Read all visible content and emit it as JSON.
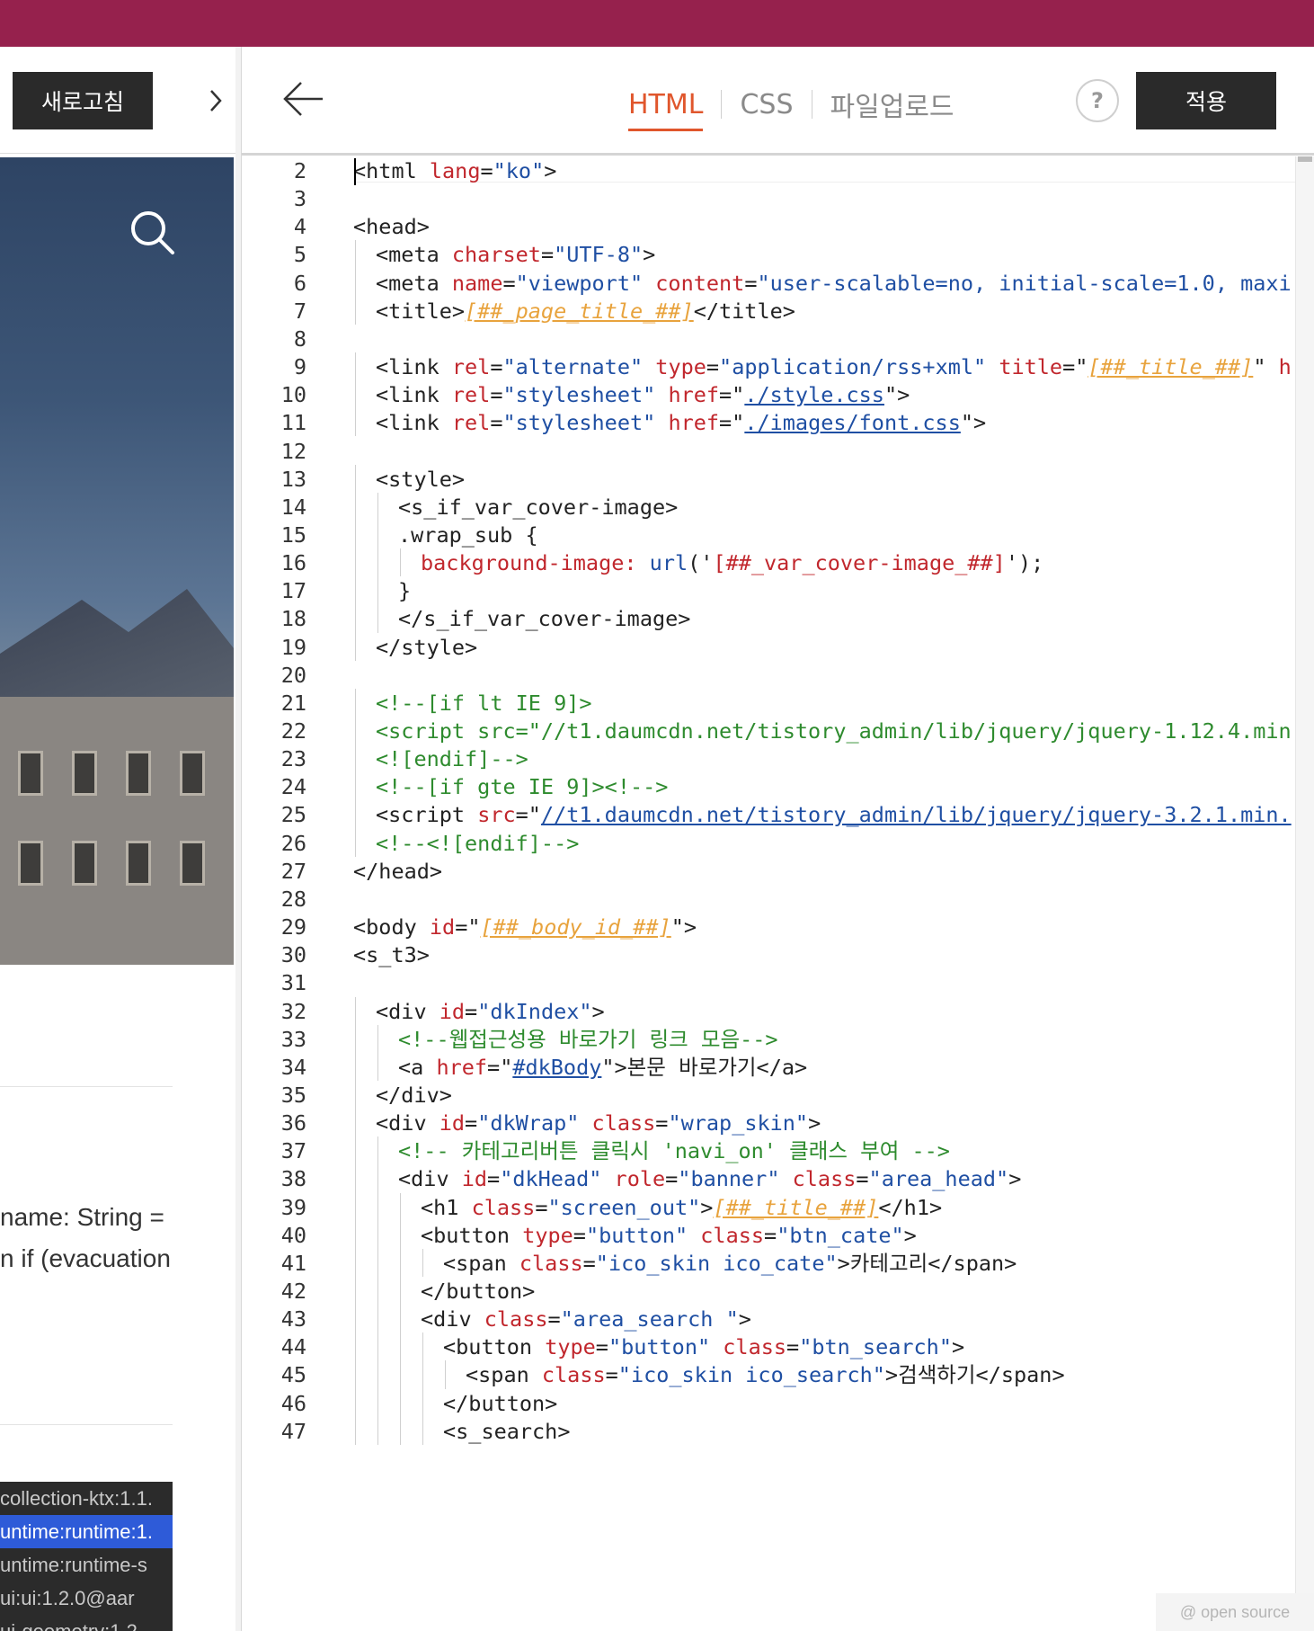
{
  "left": {
    "refresh_label": "새로고침",
    "toggle_glyph": "›",
    "text_line1": "name: String =",
    "text_line2": "n if (evacuation",
    "deps": [
      "collection-ktx:1.1.",
      "untime:runtime:1.",
      "untime:runtime-s",
      "ui:ui:1.2.0@aar",
      "ui-geometry:1.2"
    ]
  },
  "editor": {
    "tabs": [
      {
        "label": "HTML",
        "active": true
      },
      {
        "label": "CSS",
        "active": false
      },
      {
        "label": "파일업로드",
        "active": false
      }
    ],
    "help_label": "?",
    "apply_label": "적용",
    "badge": "@ open source",
    "colors": {
      "topbar": "#96214d",
      "active_tab": "#e0562c"
    }
  },
  "code_lines": [
    {
      "n": "2",
      "indent": 0,
      "seg": [
        [
          "t",
          "<html "
        ],
        [
          "a",
          "lang"
        ],
        [
          "t",
          "="
        ],
        [
          "s",
          "\"ko\""
        ],
        [
          "t",
          ">"
        ]
      ]
    },
    {
      "n": "3",
      "indent": 0,
      "seg": []
    },
    {
      "n": "4",
      "indent": 0,
      "seg": [
        [
          "t",
          "<head>"
        ]
      ]
    },
    {
      "n": "5",
      "indent": 1,
      "seg": [
        [
          "t",
          "<meta "
        ],
        [
          "a",
          "charset"
        ],
        [
          "t",
          "="
        ],
        [
          "s",
          "\"UTF-8\""
        ],
        [
          "t",
          ">"
        ]
      ]
    },
    {
      "n": "6",
      "indent": 1,
      "seg": [
        [
          "t",
          "<meta "
        ],
        [
          "a",
          "name"
        ],
        [
          "t",
          "="
        ],
        [
          "s",
          "\"viewport\""
        ],
        [
          "t",
          " "
        ],
        [
          "a",
          "content"
        ],
        [
          "t",
          "="
        ],
        [
          "s",
          "\"user-scalable=no, initial-scale=1.0, maxi"
        ]
      ]
    },
    {
      "n": "7",
      "indent": 1,
      "seg": [
        [
          "t",
          "<title>"
        ],
        [
          "tv",
          "[##_page_title_##]"
        ],
        [
          "t",
          "</title>"
        ]
      ]
    },
    {
      "n": "8",
      "indent": 0,
      "seg": []
    },
    {
      "n": "9",
      "indent": 1,
      "seg": [
        [
          "t",
          "<link "
        ],
        [
          "a",
          "rel"
        ],
        [
          "t",
          "="
        ],
        [
          "s",
          "\"alternate\""
        ],
        [
          "t",
          " "
        ],
        [
          "a",
          "type"
        ],
        [
          "t",
          "="
        ],
        [
          "s",
          "\"application/rss+xml\""
        ],
        [
          "t",
          " "
        ],
        [
          "a",
          "title"
        ],
        [
          "t",
          "=\""
        ],
        [
          "tv",
          "[##_title_##]"
        ],
        [
          "t",
          "\" "
        ],
        [
          "a",
          "h"
        ]
      ]
    },
    {
      "n": "10",
      "indent": 1,
      "seg": [
        [
          "t",
          "<link "
        ],
        [
          "a",
          "rel"
        ],
        [
          "t",
          "="
        ],
        [
          "s",
          "\"stylesheet\""
        ],
        [
          "t",
          " "
        ],
        [
          "a",
          "href"
        ],
        [
          "t",
          "=\""
        ],
        [
          "u",
          "./style.css"
        ],
        [
          "t",
          "\">"
        ]
      ]
    },
    {
      "n": "11",
      "indent": 1,
      "seg": [
        [
          "t",
          "<link "
        ],
        [
          "a",
          "rel"
        ],
        [
          "t",
          "="
        ],
        [
          "s",
          "\"stylesheet\""
        ],
        [
          "t",
          " "
        ],
        [
          "a",
          "href"
        ],
        [
          "t",
          "=\""
        ],
        [
          "u",
          "./images/font.css"
        ],
        [
          "t",
          "\">"
        ]
      ]
    },
    {
      "n": "12",
      "indent": 0,
      "seg": []
    },
    {
      "n": "13",
      "indent": 1,
      "seg": [
        [
          "t",
          "<style>"
        ]
      ]
    },
    {
      "n": "14",
      "indent": 2,
      "seg": [
        [
          "t",
          "<s_if_var_cover-image>"
        ]
      ]
    },
    {
      "n": "15",
      "indent": 2,
      "seg": [
        [
          "t",
          ".wrap_sub {"
        ]
      ]
    },
    {
      "n": "16",
      "indent": 3,
      "seg": [
        [
          "a",
          "background-image: "
        ],
        [
          "s",
          "url"
        ],
        [
          "t",
          "('"
        ],
        [
          "a",
          "[##_var_cover-image_##]"
        ],
        [
          "t",
          "');"
        ]
      ]
    },
    {
      "n": "17",
      "indent": 2,
      "seg": [
        [
          "t",
          "}"
        ]
      ]
    },
    {
      "n": "18",
      "indent": 2,
      "seg": [
        [
          "t",
          "</s_if_var_cover-image>"
        ]
      ]
    },
    {
      "n": "19",
      "indent": 1,
      "seg": [
        [
          "t",
          "</style>"
        ]
      ]
    },
    {
      "n": "20",
      "indent": 0,
      "seg": []
    },
    {
      "n": "21",
      "indent": 1,
      "seg": [
        [
          "c",
          "<!--[if lt IE 9]>"
        ]
      ]
    },
    {
      "n": "22",
      "indent": 1,
      "seg": [
        [
          "c",
          "<script src=\"//t1.daumcdn.net/tistory_admin/lib/jquery/jquery-1.12.4.min"
        ]
      ]
    },
    {
      "n": "23",
      "indent": 1,
      "seg": [
        [
          "c",
          "<![endif]-->"
        ]
      ]
    },
    {
      "n": "24",
      "indent": 1,
      "seg": [
        [
          "c",
          "<!--[if gte IE 9]><!-->"
        ]
      ]
    },
    {
      "n": "25",
      "indent": 1,
      "seg": [
        [
          "t",
          "<script "
        ],
        [
          "a",
          "src"
        ],
        [
          "t",
          "=\""
        ],
        [
          "u",
          "//t1.daumcdn.net/tistory_admin/lib/jquery/jquery-3.2.1.min."
        ]
      ]
    },
    {
      "n": "26",
      "indent": 1,
      "seg": [
        [
          "c",
          "<!--<![endif]-->"
        ]
      ]
    },
    {
      "n": "27",
      "indent": 0,
      "seg": [
        [
          "t",
          "</head>"
        ]
      ]
    },
    {
      "n": "28",
      "indent": 0,
      "seg": []
    },
    {
      "n": "29",
      "indent": 0,
      "seg": [
        [
          "t",
          "<body "
        ],
        [
          "a",
          "id"
        ],
        [
          "t",
          "=\""
        ],
        [
          "tv",
          "[##_body_id_##]"
        ],
        [
          "t",
          "\">"
        ]
      ]
    },
    {
      "n": "30",
      "indent": 0,
      "seg": [
        [
          "t",
          "<s_t3>"
        ]
      ]
    },
    {
      "n": "31",
      "indent": 0,
      "seg": []
    },
    {
      "n": "32",
      "indent": 1,
      "seg": [
        [
          "t",
          "<div "
        ],
        [
          "a",
          "id"
        ],
        [
          "t",
          "="
        ],
        [
          "s",
          "\"dkIndex\""
        ],
        [
          "t",
          ">"
        ]
      ]
    },
    {
      "n": "33",
      "indent": 2,
      "seg": [
        [
          "c",
          "<!--웹접근성용 바로가기 링크 모음-->"
        ]
      ]
    },
    {
      "n": "34",
      "indent": 2,
      "seg": [
        [
          "t",
          "<a "
        ],
        [
          "a",
          "href"
        ],
        [
          "t",
          "=\""
        ],
        [
          "u",
          "#dkBody"
        ],
        [
          "t",
          "\">본문 바로가기</a>"
        ]
      ]
    },
    {
      "n": "35",
      "indent": 1,
      "seg": [
        [
          "t",
          "</div>"
        ]
      ]
    },
    {
      "n": "36",
      "indent": 1,
      "seg": [
        [
          "t",
          "<div "
        ],
        [
          "a",
          "id"
        ],
        [
          "t",
          "="
        ],
        [
          "s",
          "\"dkWrap\""
        ],
        [
          "t",
          " "
        ],
        [
          "a",
          "class"
        ],
        [
          "t",
          "="
        ],
        [
          "s",
          "\"wrap_skin\""
        ],
        [
          "t",
          ">"
        ]
      ]
    },
    {
      "n": "37",
      "indent": 2,
      "seg": [
        [
          "c",
          "<!-- 카테고리버튼 클릭시 'navi_on' 클래스 부여 -->"
        ]
      ]
    },
    {
      "n": "38",
      "indent": 2,
      "seg": [
        [
          "t",
          "<div "
        ],
        [
          "a",
          "id"
        ],
        [
          "t",
          "="
        ],
        [
          "s",
          "\"dkHead\""
        ],
        [
          "t",
          " "
        ],
        [
          "a",
          "role"
        ],
        [
          "t",
          "="
        ],
        [
          "s",
          "\"banner\""
        ],
        [
          "t",
          " "
        ],
        [
          "a",
          "class"
        ],
        [
          "t",
          "="
        ],
        [
          "s",
          "\"area_head\""
        ],
        [
          "t",
          ">"
        ]
      ]
    },
    {
      "n": "39",
      "indent": 3,
      "seg": [
        [
          "t",
          "<h1 "
        ],
        [
          "a",
          "class"
        ],
        [
          "t",
          "="
        ],
        [
          "s",
          "\"screen_out\""
        ],
        [
          "t",
          ">"
        ],
        [
          "tv",
          "[##_title_##]"
        ],
        [
          "t",
          "</h1>"
        ]
      ]
    },
    {
      "n": "40",
      "indent": 3,
      "seg": [
        [
          "t",
          "<button "
        ],
        [
          "a",
          "type"
        ],
        [
          "t",
          "="
        ],
        [
          "s",
          "\"button\""
        ],
        [
          "t",
          " "
        ],
        [
          "a",
          "class"
        ],
        [
          "t",
          "="
        ],
        [
          "s",
          "\"btn_cate\""
        ],
        [
          "t",
          ">"
        ]
      ]
    },
    {
      "n": "41",
      "indent": 4,
      "seg": [
        [
          "t",
          "<span "
        ],
        [
          "a",
          "class"
        ],
        [
          "t",
          "="
        ],
        [
          "s",
          "\"ico_skin ico_cate\""
        ],
        [
          "t",
          ">카테고리</span>"
        ]
      ]
    },
    {
      "n": "42",
      "indent": 3,
      "seg": [
        [
          "t",
          "</button>"
        ]
      ]
    },
    {
      "n": "43",
      "indent": 3,
      "seg": [
        [
          "t",
          "<div "
        ],
        [
          "a",
          "class"
        ],
        [
          "t",
          "="
        ],
        [
          "s",
          "\"area_search \""
        ],
        [
          "t",
          ">"
        ]
      ]
    },
    {
      "n": "44",
      "indent": 4,
      "seg": [
        [
          "t",
          "<button "
        ],
        [
          "a",
          "type"
        ],
        [
          "t",
          "="
        ],
        [
          "s",
          "\"button\""
        ],
        [
          "t",
          " "
        ],
        [
          "a",
          "class"
        ],
        [
          "t",
          "="
        ],
        [
          "s",
          "\"btn_search\""
        ],
        [
          "t",
          ">"
        ]
      ]
    },
    {
      "n": "45",
      "indent": 5,
      "seg": [
        [
          "t",
          "<span "
        ],
        [
          "a",
          "class"
        ],
        [
          "t",
          "="
        ],
        [
          "s",
          "\"ico_skin ico_search\""
        ],
        [
          "t",
          ">검색하기</span>"
        ]
      ]
    },
    {
      "n": "46",
      "indent": 4,
      "seg": [
        [
          "t",
          "</button>"
        ]
      ]
    },
    {
      "n": "47",
      "indent": 4,
      "seg": [
        [
          "t",
          "<s_search>"
        ]
      ]
    }
  ]
}
